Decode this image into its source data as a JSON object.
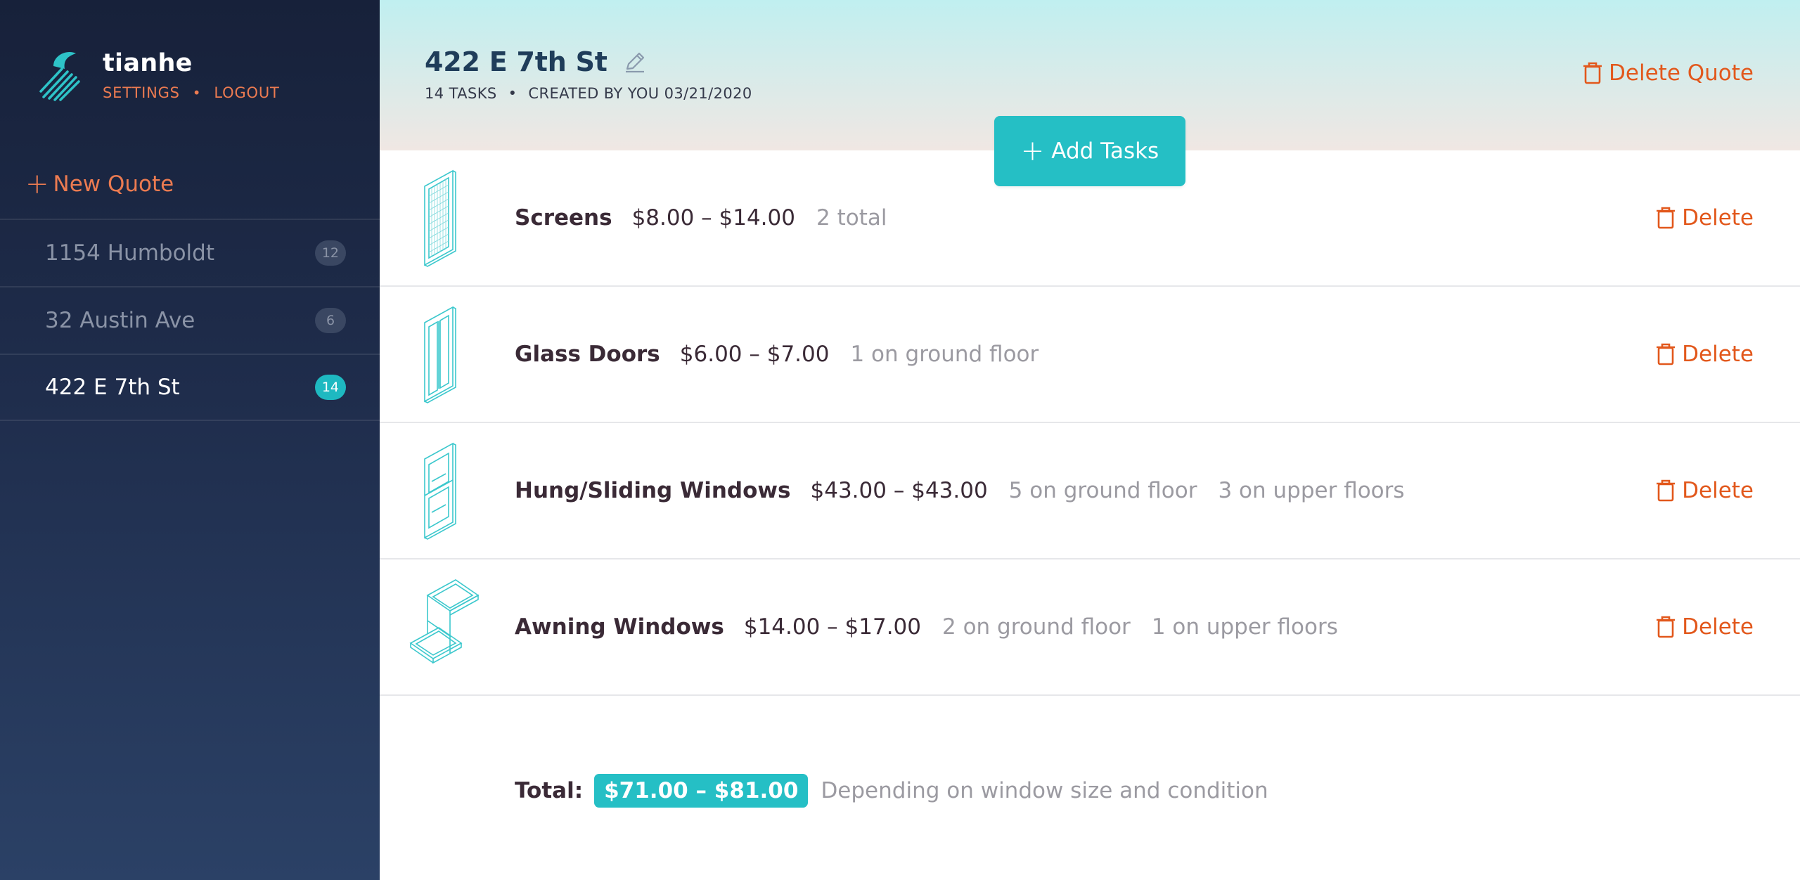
{
  "sidebar": {
    "username": "tianhe",
    "settings_label": "SETTINGS",
    "separator": "•",
    "logout_label": "LOGOUT",
    "new_quote_plus": "+",
    "new_quote_label": "New Quote",
    "quotes": [
      {
        "name": "1154 Humboldt",
        "count": "12",
        "active": false
      },
      {
        "name": "32 Austin Ave",
        "count": "6",
        "active": false
      },
      {
        "name": "422 E 7th St",
        "count": "14",
        "active": true
      }
    ]
  },
  "header": {
    "title": "422 E 7th St",
    "tasks_count": "14 TASKS",
    "separator": "•",
    "created": "CREATED BY YOU 03/21/2020",
    "delete_quote_label": "Delete Quote",
    "add_tasks_plus": "+",
    "add_tasks_label": "Add Tasks"
  },
  "tasks": [
    {
      "name": "Screens",
      "price": "$8.00 – $14.00",
      "detail1": "2 total",
      "detail2": "",
      "icon": "screen-icon",
      "delete_label": "Delete"
    },
    {
      "name": "Glass Doors",
      "price": "$6.00 – $7.00",
      "detail1": "1 on ground floor",
      "detail2": "",
      "icon": "glass-door-icon",
      "delete_label": "Delete"
    },
    {
      "name": "Hung/Sliding Windows",
      "price": "$43.00 – $43.00",
      "detail1": "5 on ground floor",
      "detail2": "3 on upper floors",
      "icon": "hung-window-icon",
      "delete_label": "Delete"
    },
    {
      "name": "Awning Windows",
      "price": "$14.00 – $17.00",
      "detail1": "2 on ground floor",
      "detail2": "1 on upper floors",
      "icon": "awning-window-icon",
      "delete_label": "Delete"
    }
  ],
  "total": {
    "label": "Total:",
    "range": "$71.00 – $81.00",
    "note": "Depending on window size and condition"
  },
  "colors": {
    "accent_teal": "#25bfc5",
    "accent_orange": "#e2581c",
    "sidebar_top": "#17213a",
    "sidebar_bottom": "#2b4166",
    "header_top": "#c0eff0",
    "header_bottom": "#f0e7e3"
  }
}
